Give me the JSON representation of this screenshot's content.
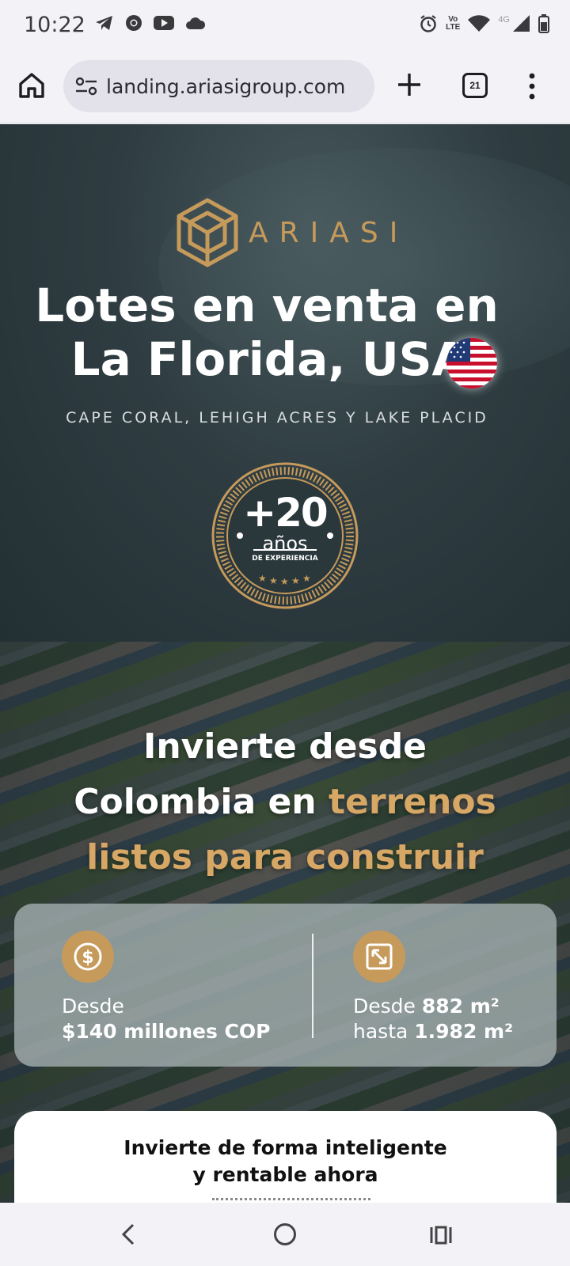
{
  "status_bar": {
    "time": "10:22",
    "left_icons": [
      "telegram-icon",
      "chrome-icon",
      "youtube-icon",
      "cloud-icon"
    ],
    "right_icons": [
      "alarm-icon",
      "volte-icon",
      "wifi-icon",
      "signal-icon",
      "battery-icon"
    ],
    "volte_label": "Vo\nLTE",
    "network_label": "4G"
  },
  "browser": {
    "url": "landing.ariasigroup.com",
    "tab_count": "21"
  },
  "hero": {
    "logo_text": "ARIASI",
    "title_line1": "Lotes en venta en",
    "title_line2": "La Florida, USA",
    "subtitle": "CAPE CORAL, LEHIGH ACRES Y LAKE PLACID",
    "badge_number": "+20",
    "badge_years": "años",
    "badge_experience": "DE EXPERIENCIA"
  },
  "invest": {
    "line1": "Invierte desde",
    "line2_white": "Colombia en ",
    "line2_gold": "terrenos",
    "line3_gold": "listos para construir",
    "accent_color": "#d7a766"
  },
  "stats": {
    "price_label": "Desde",
    "price_value": "$140 millones COP",
    "size_from_label": "Desde",
    "size_from_value": "882 m²",
    "size_to_label": "hasta",
    "size_to_value": "1.982 m²"
  },
  "cta_card": {
    "title_line1": "Invierte de forma inteligente",
    "title_line2": "y rentable ahora"
  },
  "colors": {
    "brand_gold": "#c69a5b",
    "hero_bg": "#2f3d42"
  }
}
